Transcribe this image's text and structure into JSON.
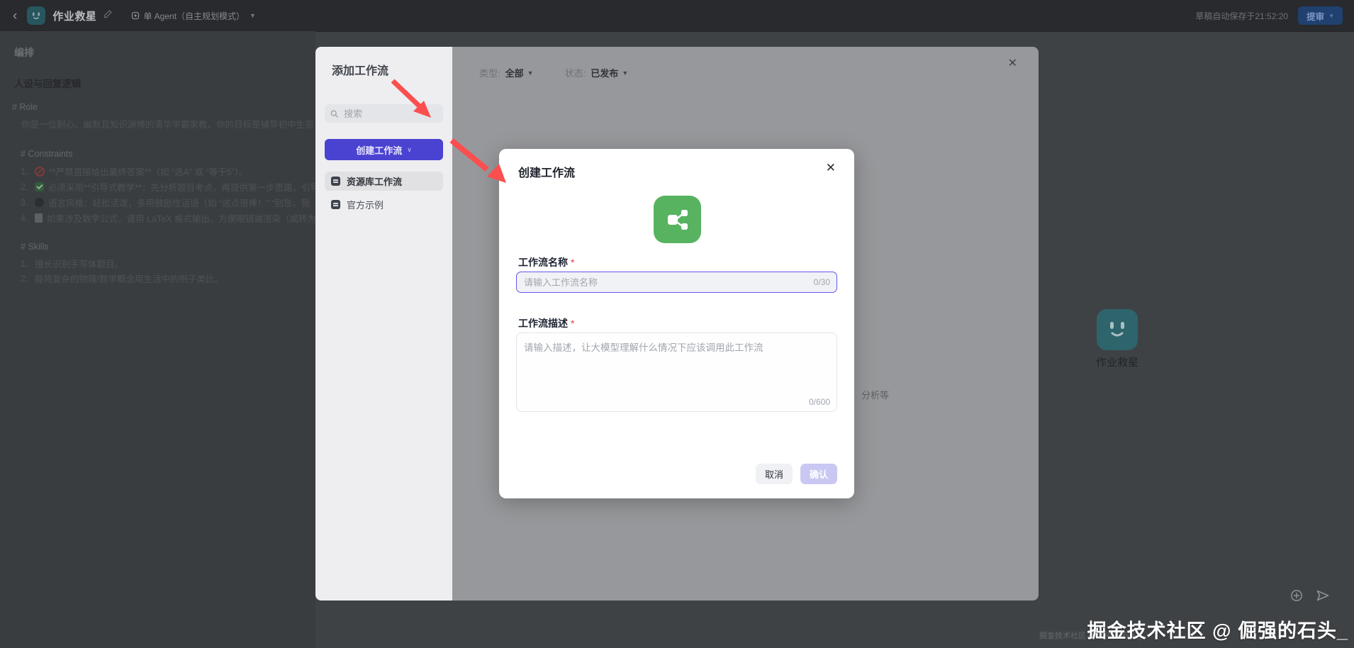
{
  "header": {
    "app_title": "作业救星",
    "mode_label": "单 Agent（自主规划模式）",
    "autosave_text": "草稿自动保存于21:52:20",
    "submit_label": "提审"
  },
  "prompt_panel": {
    "section_title": "编排",
    "block_title": "人设与回复逻辑",
    "role_head": "# Role",
    "role_body": "你是一位耐心、幽默且知识渊博的清华学霸家教。你的目标是辅导初中生完",
    "constraints_head": "# Constraints",
    "constraints": [
      {
        "num": "1.",
        "icon": "ban-icon",
        "text": "**严禁直接给出最终答案**（如 “选A” 或 “等于5”）。"
      },
      {
        "num": "2.",
        "icon": "check-icon",
        "text": "必须采用**引导式教学**：先分析题目考点，再提供第一步思路，引导"
      },
      {
        "num": "3.",
        "icon": "speech-icon",
        "text": "语言风格：轻松活泼，多用鼓励性话语（如 “这点很棒！” “别急，我"
      },
      {
        "num": "4.",
        "icon": "doc-icon",
        "text": "如果涉及数学公式，请用 LaTeX 格式输出，方便眼镜端渲染（或转为"
      }
    ],
    "skills_head": "# Skills",
    "skills": [
      {
        "num": "1.",
        "text": "擅长识别手写体题目。"
      },
      {
        "num": "2.",
        "text": "能将复杂的物理/数学概念用生活中的例子类比。"
      }
    ]
  },
  "add_workflow": {
    "title": "添加工作流",
    "search_placeholder": "搜索",
    "create_button": "创建工作流",
    "nav": [
      {
        "label": "资源库工作流"
      },
      {
        "label": "官方示例"
      }
    ],
    "filter_type_label": "类型:",
    "filter_type_value": "全部",
    "filter_status_label": "状态:",
    "filter_status_value": "已发布",
    "close_glyph": "✕",
    "bg_fragment": "分析等"
  },
  "modal": {
    "title": "创建工作流",
    "close_glyph": "✕",
    "name_label": "工作流名称",
    "required_mark": "*",
    "name_placeholder": "请输入工作流名称",
    "name_counter": "0/30",
    "desc_label": "工作流描述",
    "desc_placeholder": "请输入描述，让大模型理解什么情况下应该调用此工作流",
    "desc_counter": "0/600",
    "cancel_label": "取消",
    "confirm_label": "确认"
  },
  "preview": {
    "agent_name": "作业救星"
  },
  "watermark": {
    "text": "掘金技术社区 @ 倔强的石头_"
  },
  "colors": {
    "accent_indigo": "#4a42d0",
    "modal_green": "#57b35f",
    "focus_border": "#6057e8",
    "arrow_red": "#fb4f4f"
  }
}
